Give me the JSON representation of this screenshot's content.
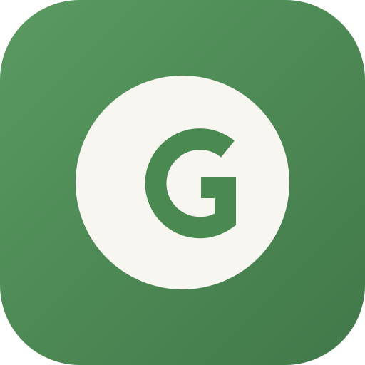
{
  "app_icon": {
    "letter": "G",
    "icon_name": "letter-g-logo-icon",
    "colors": {
      "background_top": "#5a9b62",
      "background_bottom": "#42784a",
      "badge": "#f8f6f0",
      "letter": "#4a8a51"
    }
  }
}
